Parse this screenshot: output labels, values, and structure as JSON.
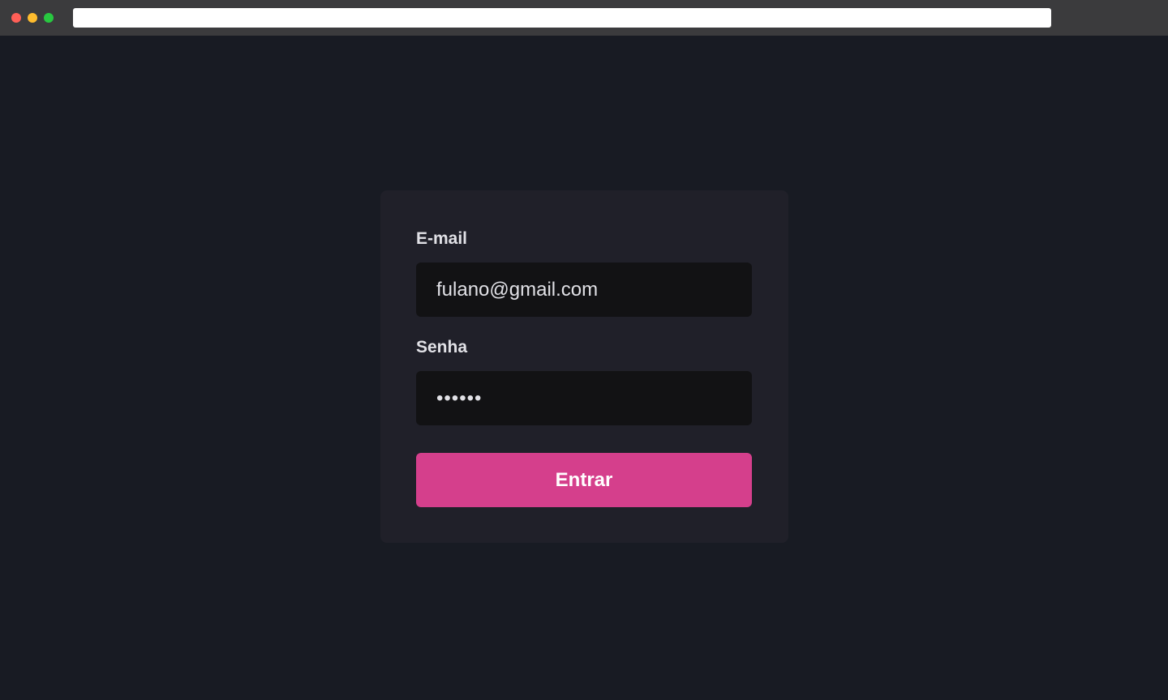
{
  "window": {
    "url": "",
    "colors": {
      "close": "#ff5f57",
      "minimize": "#febc2e",
      "maximize": "#28c840"
    }
  },
  "login": {
    "email_label": "E-mail",
    "email_value": "fulano@gmail.com",
    "password_label": "Senha",
    "password_value": "••••••",
    "submit_label": "Entrar"
  },
  "colors": {
    "background": "#181b23",
    "card": "#202029",
    "input": "#121214",
    "accent": "#d53f8c"
  }
}
